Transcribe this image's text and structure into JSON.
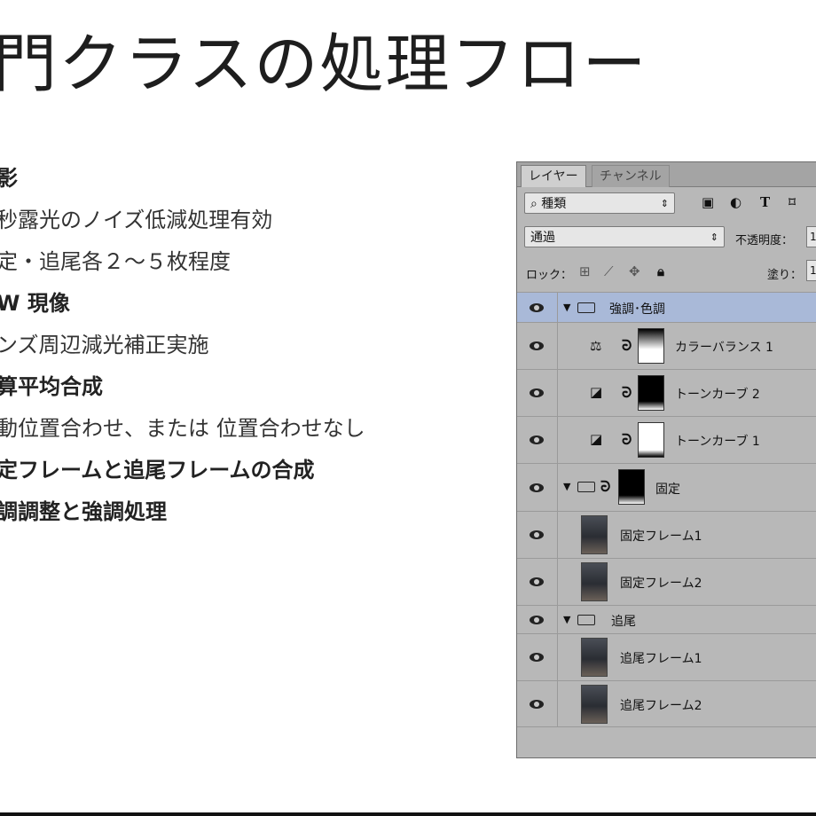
{
  "slide": {
    "title": "門クラスの処理フロー",
    "bullets": [
      {
        "text": "影",
        "bold": true
      },
      {
        "text": "秒露光のノイズ低減処理有効",
        "bold": false
      },
      {
        "text": "定・追尾各２～５枚程度",
        "bold": false
      },
      {
        "text": "W 現像",
        "bold": true
      },
      {
        "text": "ンズ周辺減光補正実施",
        "bold": false
      },
      {
        "text": "算平均合成",
        "bold": true
      },
      {
        "text": "動位置合わせ、または 位置合わせなし",
        "bold": false
      },
      {
        "text": "定フレームと追尾フレームの合成",
        "bold": true
      },
      {
        "text": "調調整と強調処理",
        "bold": true
      }
    ]
  },
  "panel": {
    "tabs": [
      "レイヤー",
      "チャンネル"
    ],
    "filter_kind": "種類",
    "blend_mode": "通過",
    "opacity_label": "不透明度：",
    "opacity_value": "1",
    "lock_label": "ロック：",
    "fill_label": "塗り：",
    "fill_value": "1",
    "filter_icons": [
      "image-filter-icon",
      "adjustment-filter-icon",
      "type-filter-icon",
      "shape-filter-icon"
    ],
    "layers": [
      {
        "name": "強調･色調",
        "kind": "group",
        "selected": true
      },
      {
        "name": "カラーバランス 1",
        "kind": "adjustment-color-balance"
      },
      {
        "name": "トーンカーブ 2",
        "kind": "adjustment-curves"
      },
      {
        "name": "トーンカーブ 1",
        "kind": "adjustment-curves"
      },
      {
        "name": "固定",
        "kind": "group-masked"
      },
      {
        "name": "固定フレーム1",
        "kind": "pixel"
      },
      {
        "name": "固定フレーム2",
        "kind": "pixel"
      },
      {
        "name": "追尾",
        "kind": "group"
      },
      {
        "name": "追尾フレーム1",
        "kind": "pixel"
      },
      {
        "name": "追尾フレーム2",
        "kind": "pixel"
      }
    ]
  }
}
